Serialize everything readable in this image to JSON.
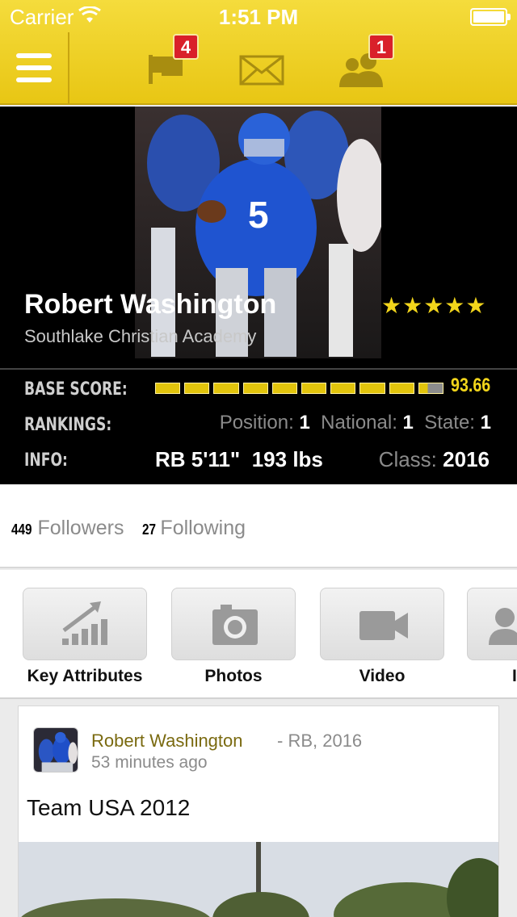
{
  "status_bar": {
    "carrier": "Carrier",
    "time": "1:51 PM"
  },
  "nav": {
    "flag_badge": "4",
    "mail_badge": "",
    "people_badge": "1"
  },
  "profile": {
    "name": "Robert Washington",
    "school": "Southlake Christian Academy",
    "stars": "★★★★★",
    "star_count": 5
  },
  "stats": {
    "base_score_label": "BASE SCORE:",
    "base_score": "93.66",
    "base_score_fraction": 0.9366,
    "rankings_label": "RANKINGS:",
    "position_label": "Position:",
    "position": "1",
    "national_label": "National:",
    "national": "1",
    "state_label": "State:",
    "state": "1",
    "info_label": "INFO:",
    "position_code": "RB",
    "height": "5'11\"",
    "weight": "193 lbs",
    "class_label": "Class:",
    "class_year": "2016"
  },
  "social": {
    "followers_count": "449",
    "followers_label": "Followers",
    "following_count": "27",
    "following_label": "Following"
  },
  "tabs": [
    {
      "label": "Key Attributes",
      "icon": "bar-chart-icon"
    },
    {
      "label": "Photos",
      "icon": "camera-icon"
    },
    {
      "label": "Video",
      "icon": "video-camera-icon"
    },
    {
      "label": "I",
      "icon": "person-icon"
    }
  ],
  "feed": {
    "author": "Robert Washington",
    "meta": "- RB, 2016",
    "time": "53 minutes ago",
    "text": "Team USA 2012"
  },
  "colors": {
    "header_yellow": "#e8c614",
    "score_yellow": "#f2d51b",
    "badge_red": "#d9202a",
    "author_olive": "#7a6a10"
  }
}
